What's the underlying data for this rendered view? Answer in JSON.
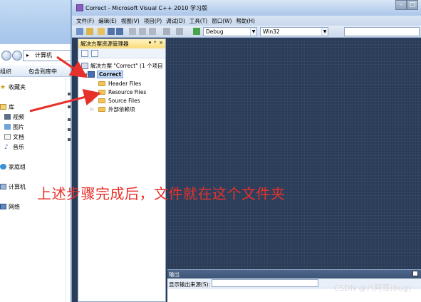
{
  "explorer": {
    "address": "计算机",
    "toolbar": {
      "organize": "组织",
      "include_library": "包含到库中"
    },
    "nav": {
      "favorites": "收藏夹",
      "library": "库",
      "videos": "视频",
      "pictures": "图片",
      "documents": "文档",
      "music": "音乐",
      "homegroup": "家庭组",
      "computer": "计算机",
      "network": "网络"
    }
  },
  "vs": {
    "title": "Correct - Microsoft Visual C++ 2010 学习版",
    "menu": [
      "文件(F)",
      "编辑(E)",
      "视图(V)",
      "项目(P)",
      "调试(D)",
      "工具(T)",
      "窗口(W)",
      "帮助(H)"
    ],
    "toolbar": {
      "config": "Debug",
      "platform": "Win32",
      "search": ""
    },
    "solution_explorer": {
      "title": "解决方案资源管理器",
      "controls": [
        "▾",
        "ᵠ",
        "×"
      ],
      "solution_node": "解决方案 \"Correct\" (1 个项目",
      "project_node": "Correct",
      "folders": [
        "Header Files",
        "Resource Files",
        "Source Files",
        "外部依赖项"
      ]
    },
    "output": {
      "title": "输出",
      "source_label": "显示输出来源(S):",
      "source_value": ""
    }
  },
  "annotation": {
    "text": "上述步骤完成后，文件就在这个文件夹",
    "color": "#e8302a"
  },
  "watermark": "CSDN @八阿哥(bug)"
}
